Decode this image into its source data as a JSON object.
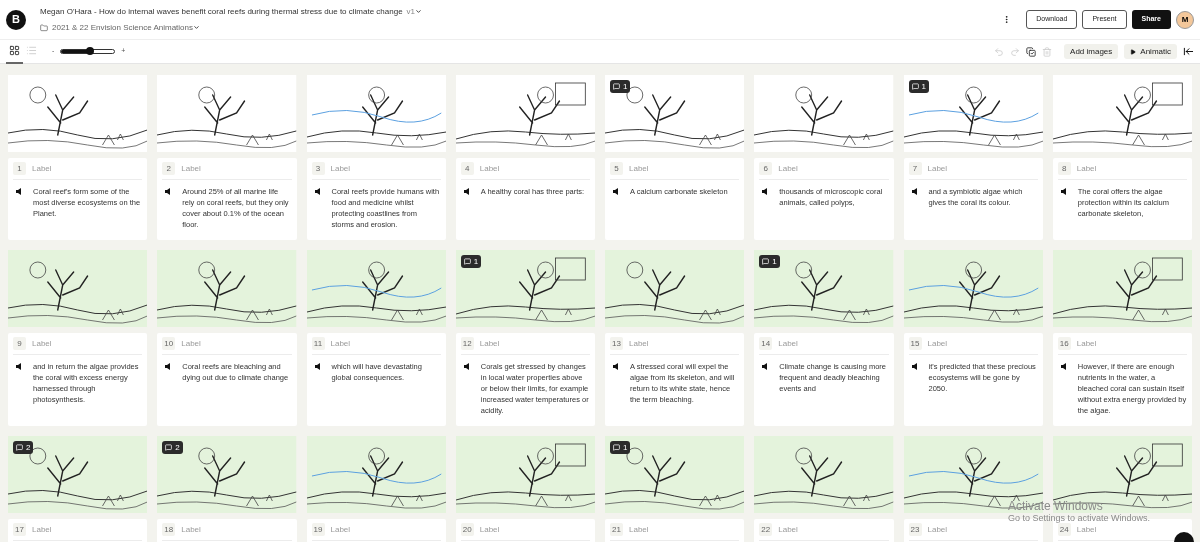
{
  "header": {
    "logo": "B",
    "title": "Megan O'Hara - How do internal waves benefit coral reefs during thermal stress due to climate change",
    "version": "v1",
    "project": "2021 & 22 Envision Science Animations",
    "buttons": [
      {
        "label": "Download",
        "kind": "outline"
      },
      {
        "label": "Present",
        "kind": "outline"
      },
      {
        "label": "Share",
        "kind": "solid"
      }
    ],
    "avatar": "M"
  },
  "toolbar": {
    "views": [
      {
        "kind": "grid",
        "selected": true
      },
      {
        "kind": "list",
        "selected": false
      }
    ],
    "zoom_out": "-",
    "zoom_in": "+",
    "zoom": {
      "level": 0.55
    },
    "actions": [
      {
        "kind": "undo",
        "disabled": true
      },
      {
        "kind": "redo",
        "disabled": true
      },
      {
        "kind": "duplicate",
        "disabled": false
      },
      {
        "kind": "delete",
        "disabled": true
      }
    ],
    "add_images": "Add images",
    "animatic": "Animatic"
  },
  "frames": [
    {
      "number": "1",
      "placeholder": "Label",
      "text": "Coral reef's form some of the most diverse ecosystems on the Planet.",
      "tinted": false
    },
    {
      "number": "2",
      "placeholder": "Label",
      "text": "Around 25% of all marine life rely on coral reefs, but they only cover about 0.1% of the ocean floor.",
      "tinted": false
    },
    {
      "number": "3",
      "placeholder": "Label",
      "text": "Coral reefs provide humans with food and medicine whilst protecting coastlines from storms and erosion.",
      "tinted": false
    },
    {
      "number": "4",
      "placeholder": "Label",
      "text": "A healthy coral has three parts:",
      "tinted": false
    },
    {
      "number": "5",
      "placeholder": "Label",
      "text": "A calcium carbonate skeleton",
      "comments": "1",
      "tinted": false
    },
    {
      "number": "6",
      "placeholder": "Label",
      "text": "thousands of microscopic coral animals, called polyps,",
      "tinted": false
    },
    {
      "number": "7",
      "placeholder": "Label",
      "text": "and a symbiotic algae which gives the coral its colour.",
      "comments": "1",
      "tinted": false
    },
    {
      "number": "8",
      "placeholder": "Label",
      "text": "The coral offers the algae protection within its calcium carbonate skeleton,",
      "tinted": false
    },
    {
      "number": "9",
      "placeholder": "Label",
      "text": "and in return the algae provides the coral with excess energy harnessed through photosynthesis.",
      "tinted": true
    },
    {
      "number": "10",
      "placeholder": "Label",
      "text": "Coral reefs are bleaching and dying out due to climate change",
      "tinted": true
    },
    {
      "number": "11",
      "placeholder": "Label",
      "text": "which will have devastating global consequences.",
      "tinted": true
    },
    {
      "number": "12",
      "placeholder": "Label",
      "text": "Corals get stressed by changes in local water properties above or below their limits, for example increased water temperatures or acidity.",
      "comments": "1",
      "tinted": true
    },
    {
      "number": "13",
      "placeholder": "Label",
      "text": "A stressed coral will expel the algae from its skeleton, and will return to its white state, hence the term bleaching.",
      "tinted": true
    },
    {
      "number": "14",
      "placeholder": "Label",
      "text": "Climate change is causing more frequent and deadly bleaching events and",
      "comments": "1",
      "tinted": true
    },
    {
      "number": "15",
      "placeholder": "Label",
      "text": "it's predicted that these precious ecosystems will be gone by 2050.",
      "tinted": true
    },
    {
      "number": "16",
      "placeholder": "Label",
      "text": "However, if there are enough nutrients in the water, a bleached coral can sustain itself without extra energy provided by the algae.",
      "tinted": true
    },
    {
      "number": "17",
      "placeholder": "Label",
      "comments": "2",
      "tinted": true
    },
    {
      "number": "18",
      "placeholder": "Label",
      "comments": "2",
      "tinted": true
    },
    {
      "number": "19",
      "placeholder": "Label",
      "tinted": true
    },
    {
      "number": "20",
      "placeholder": "Label",
      "tinted": true
    },
    {
      "number": "21",
      "placeholder": "Label",
      "comments": "1",
      "tinted": true
    },
    {
      "number": "22",
      "placeholder": "Label",
      "tinted": true
    },
    {
      "number": "23",
      "placeholder": "Label",
      "tinted": true
    },
    {
      "number": "24",
      "placeholder": "Label",
      "tinted": true
    }
  ],
  "overlay": {
    "title": "Activate Windows",
    "message": "Go to Settings to activate Windows."
  }
}
